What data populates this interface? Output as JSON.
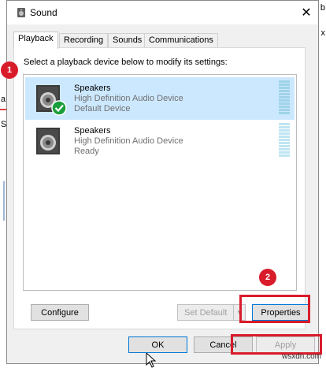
{
  "window": {
    "title": "Sound"
  },
  "background": {
    "frag_a": "a",
    "frag_s": "S",
    "frag_b": "b",
    "frag_x": "x"
  },
  "tabs": [
    {
      "label": "Playback"
    },
    {
      "label": "Recording"
    },
    {
      "label": "Sounds"
    },
    {
      "label": "Communications"
    }
  ],
  "panel": {
    "instruction": "Select a playback device below to modify its settings:"
  },
  "devices": [
    {
      "name": "Speakers",
      "description": "High Definition Audio Device",
      "status": "Default Device",
      "selected": true
    },
    {
      "name": "Speakers",
      "description": "High Definition Audio Device",
      "status": "Ready",
      "selected": false
    }
  ],
  "buttons": {
    "configure": "Configure",
    "set_default": "Set Default",
    "properties": "Properties",
    "ok": "OK",
    "cancel": "Cancel",
    "apply": "Apply"
  },
  "annotations": {
    "badge1": "1",
    "badge2": "2"
  },
  "watermark": "wsxdn.com",
  "colors": {
    "accent": "#d91c2a",
    "selection": "#cce8ff",
    "check": "#1a9e3c"
  }
}
